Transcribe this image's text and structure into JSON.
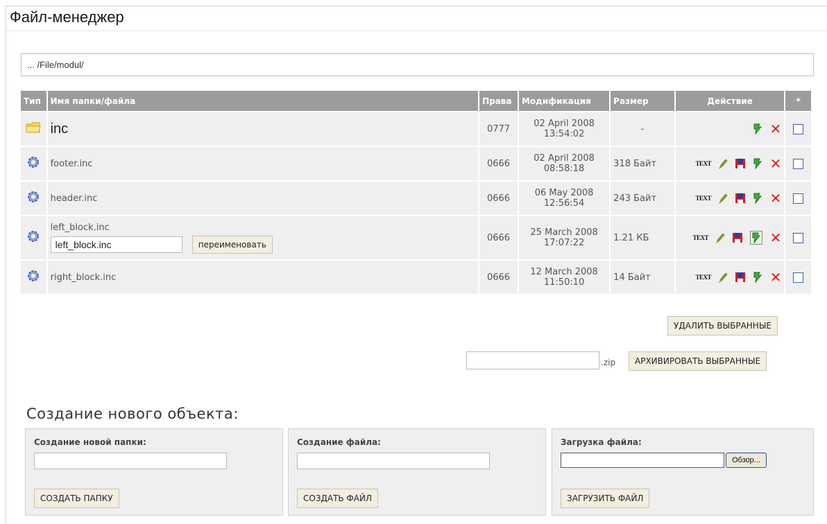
{
  "header": {
    "title": "Файл-менеджер"
  },
  "path": "... /File/modul/",
  "table": {
    "columns": [
      "Тип",
      "Имя папки/файла",
      "Права",
      "Модификация",
      "Размер",
      "Действие",
      "*"
    ],
    "rows": [
      {
        "name": "inc",
        "perms": "0777",
        "date": "02 April 2008",
        "time": "13:54:02",
        "size": "-",
        "kind": "folder"
      },
      {
        "name": "footer.inc",
        "perms": "0666",
        "date": "02 April 2008",
        "time": "08:58:18",
        "size": "318 Байт",
        "kind": "file"
      },
      {
        "name": "header.inc",
        "perms": "0666",
        "date": "06 May 2008",
        "time": "12:56:54",
        "size": "243 Байт",
        "kind": "file"
      },
      {
        "name": "left_block.inc",
        "perms": "0666",
        "date": "25 March 2008",
        "time": "17:07:22",
        "size": "1.21 КБ",
        "kind": "file",
        "rename_value": "left_block.inc",
        "rename_label": "переименовать"
      },
      {
        "name": "right_block.inc",
        "perms": "0666",
        "date": "12 March 2008",
        "time": "11:50:10",
        "size": "14 Байт",
        "kind": "file"
      }
    ],
    "action_text_label": "TEXT"
  },
  "actions": {
    "delete_selected": "УДАЛИТЬ ВЫБРАННЫЕ",
    "zip_suffix": ".zip",
    "archive_selected": "АРХИВИРОВАТЬ ВЫБРАННЫЕ"
  },
  "create": {
    "title": "Создание нового объекта:",
    "folder": {
      "label": "Создание новой папки:",
      "button": "СОЗДАТЬ ПАПКУ"
    },
    "file": {
      "label": "Создание файла:",
      "button": "СОЗДАТЬ ФАЙЛ"
    },
    "upload": {
      "label": "Загрузка файла:",
      "browse": "Обзор...",
      "button": "ЗАГРУЗИТЬ ФАЙЛ"
    }
  },
  "colors": {
    "header_bg": "#9c9c9c",
    "row_bg": "#efefef",
    "delete_red": "#e02020",
    "button_bg": "#f2eee0"
  }
}
